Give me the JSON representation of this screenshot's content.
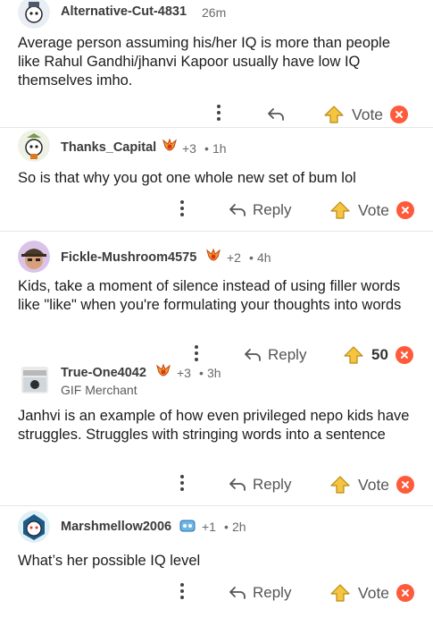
{
  "comments": [
    {
      "username": "Alternative-Cut-4831",
      "time": "26m",
      "text": "Average person assuming his/her IQ is more than people like Rahul Gandhi/jhanvi Kapoor usually have low IQ themselves imho.",
      "reply_label": "",
      "vote_label": "Vote"
    },
    {
      "username": "Thanks_Capital",
      "awards": "+3",
      "time": "1h",
      "text": "So is that why you got one whole new set of bum lol",
      "reply_label": "Reply",
      "vote_label": "Vote"
    },
    {
      "username": "Fickle-Mushroom4575",
      "awards": "+2",
      "time": "4h",
      "text": "Kids, take a moment of silence instead of using filler words like \"like\" when you're formulating your thoughts into words",
      "reply_label": "Reply",
      "vote_label": "50"
    },
    {
      "username": "True-One4042",
      "awards": "+3",
      "time": "3h",
      "flair": "GIF Merchant",
      "text": "Janhvi is an example of how even privileged nepo kids have struggles. Struggles with stringing words into a sentence",
      "reply_label": "Reply",
      "vote_label": "Vote"
    },
    {
      "username": "Marshmellow2006",
      "awards": "+1",
      "time": "2h",
      "text": "What’s her possible IQ level",
      "reply_label": "Reply",
      "vote_label": "Vote"
    }
  ],
  "separator": "•",
  "colors": {
    "upvote": "#f5c542",
    "downvote": "#ff5a3a",
    "text": "#1c1c1c",
    "muted": "#6a6a6a"
  },
  "icons": [
    "more-icon",
    "reply-icon",
    "upvote-icon",
    "downvote-icon",
    "award-icon"
  ]
}
